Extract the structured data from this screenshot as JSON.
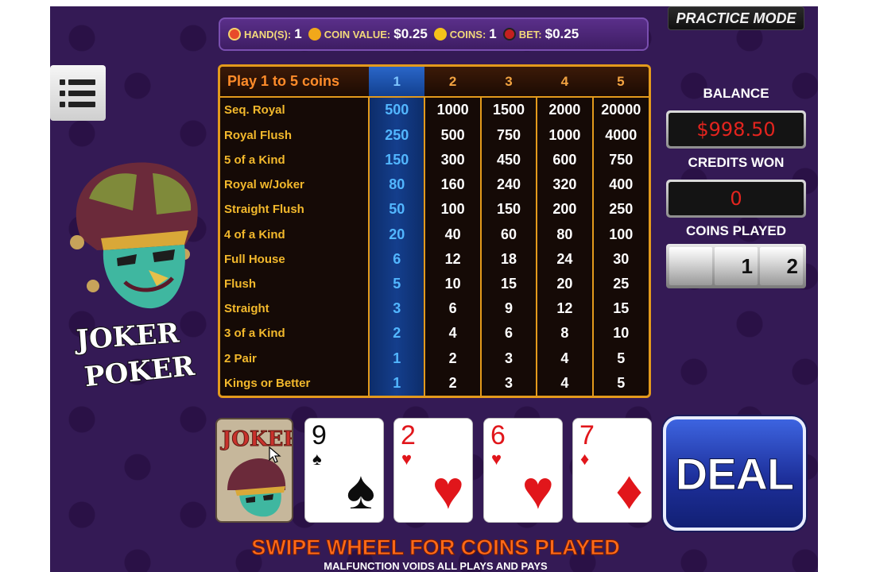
{
  "top_bar": {
    "hands_label": "HAND(S):",
    "hands_value": "1",
    "coin_value_label": "COIN VALUE:",
    "coin_value": "$0.25",
    "coins_label": "COINS:",
    "coins_value": "1",
    "bet_label": "BET:",
    "bet_value": "$0.25"
  },
  "practice_mode": "PRACTICE MODE",
  "logo": {
    "line1": "JOKER",
    "line2": "POKER"
  },
  "paytable": {
    "header": "Play 1 to 5 coins",
    "coin_columns": [
      "1",
      "2",
      "3",
      "4",
      "5"
    ],
    "selected_column": 0,
    "rows": [
      {
        "hand": "Seq. Royal",
        "pays": [
          "500",
          "1000",
          "1500",
          "2000",
          "20000"
        ]
      },
      {
        "hand": "Royal Flush",
        "pays": [
          "250",
          "500",
          "750",
          "1000",
          "4000"
        ]
      },
      {
        "hand": "5 of a Kind",
        "pays": [
          "150",
          "300",
          "450",
          "600",
          "750"
        ]
      },
      {
        "hand": "Royal w/Joker",
        "pays": [
          "80",
          "160",
          "240",
          "320",
          "400"
        ]
      },
      {
        "hand": "Straight Flush",
        "pays": [
          "50",
          "100",
          "150",
          "200",
          "250"
        ]
      },
      {
        "hand": "4 of a Kind",
        "pays": [
          "20",
          "40",
          "60",
          "80",
          "100"
        ]
      },
      {
        "hand": "Full House",
        "pays": [
          "6",
          "12",
          "18",
          "24",
          "30"
        ]
      },
      {
        "hand": "Flush",
        "pays": [
          "5",
          "10",
          "15",
          "20",
          "25"
        ]
      },
      {
        "hand": "Straight",
        "pays": [
          "3",
          "6",
          "9",
          "12",
          "15"
        ]
      },
      {
        "hand": "3 of a Kind",
        "pays": [
          "2",
          "4",
          "6",
          "8",
          "10"
        ]
      },
      {
        "hand": "2 Pair",
        "pays": [
          "1",
          "2",
          "3",
          "4",
          "5"
        ]
      },
      {
        "hand": "Kings or Better",
        "pays": [
          "1",
          "2",
          "3",
          "4",
          "5"
        ]
      }
    ]
  },
  "right_panel": {
    "balance_label": "BALANCE",
    "balance_value": "$998.50",
    "credits_won_label": "CREDITS WON",
    "credits_won_value": "0",
    "coins_played_label": "COINS PLAYED",
    "coins_played_wheel": [
      "",
      "1",
      "2"
    ]
  },
  "cards": [
    {
      "id": "joker",
      "label": "JOKER"
    },
    {
      "rank": "9",
      "suit": "♠",
      "color": "black"
    },
    {
      "rank": "2",
      "suit": "♥",
      "color": "red"
    },
    {
      "rank": "6",
      "suit": "♥",
      "color": "red"
    },
    {
      "rank": "7",
      "suit": "♦",
      "color": "red"
    }
  ],
  "deal_button": "DEAL",
  "footer": {
    "swipe_text": "SWIPE WHEEL FOR COINS PLAYED",
    "malfunction_text": "MALFUNCTION VOIDS ALL PLAYS AND PAYS"
  },
  "colors": {
    "accent_orange": "#e39a1c",
    "selected_blue": "#143e8c",
    "balance_red": "#e3241e"
  }
}
